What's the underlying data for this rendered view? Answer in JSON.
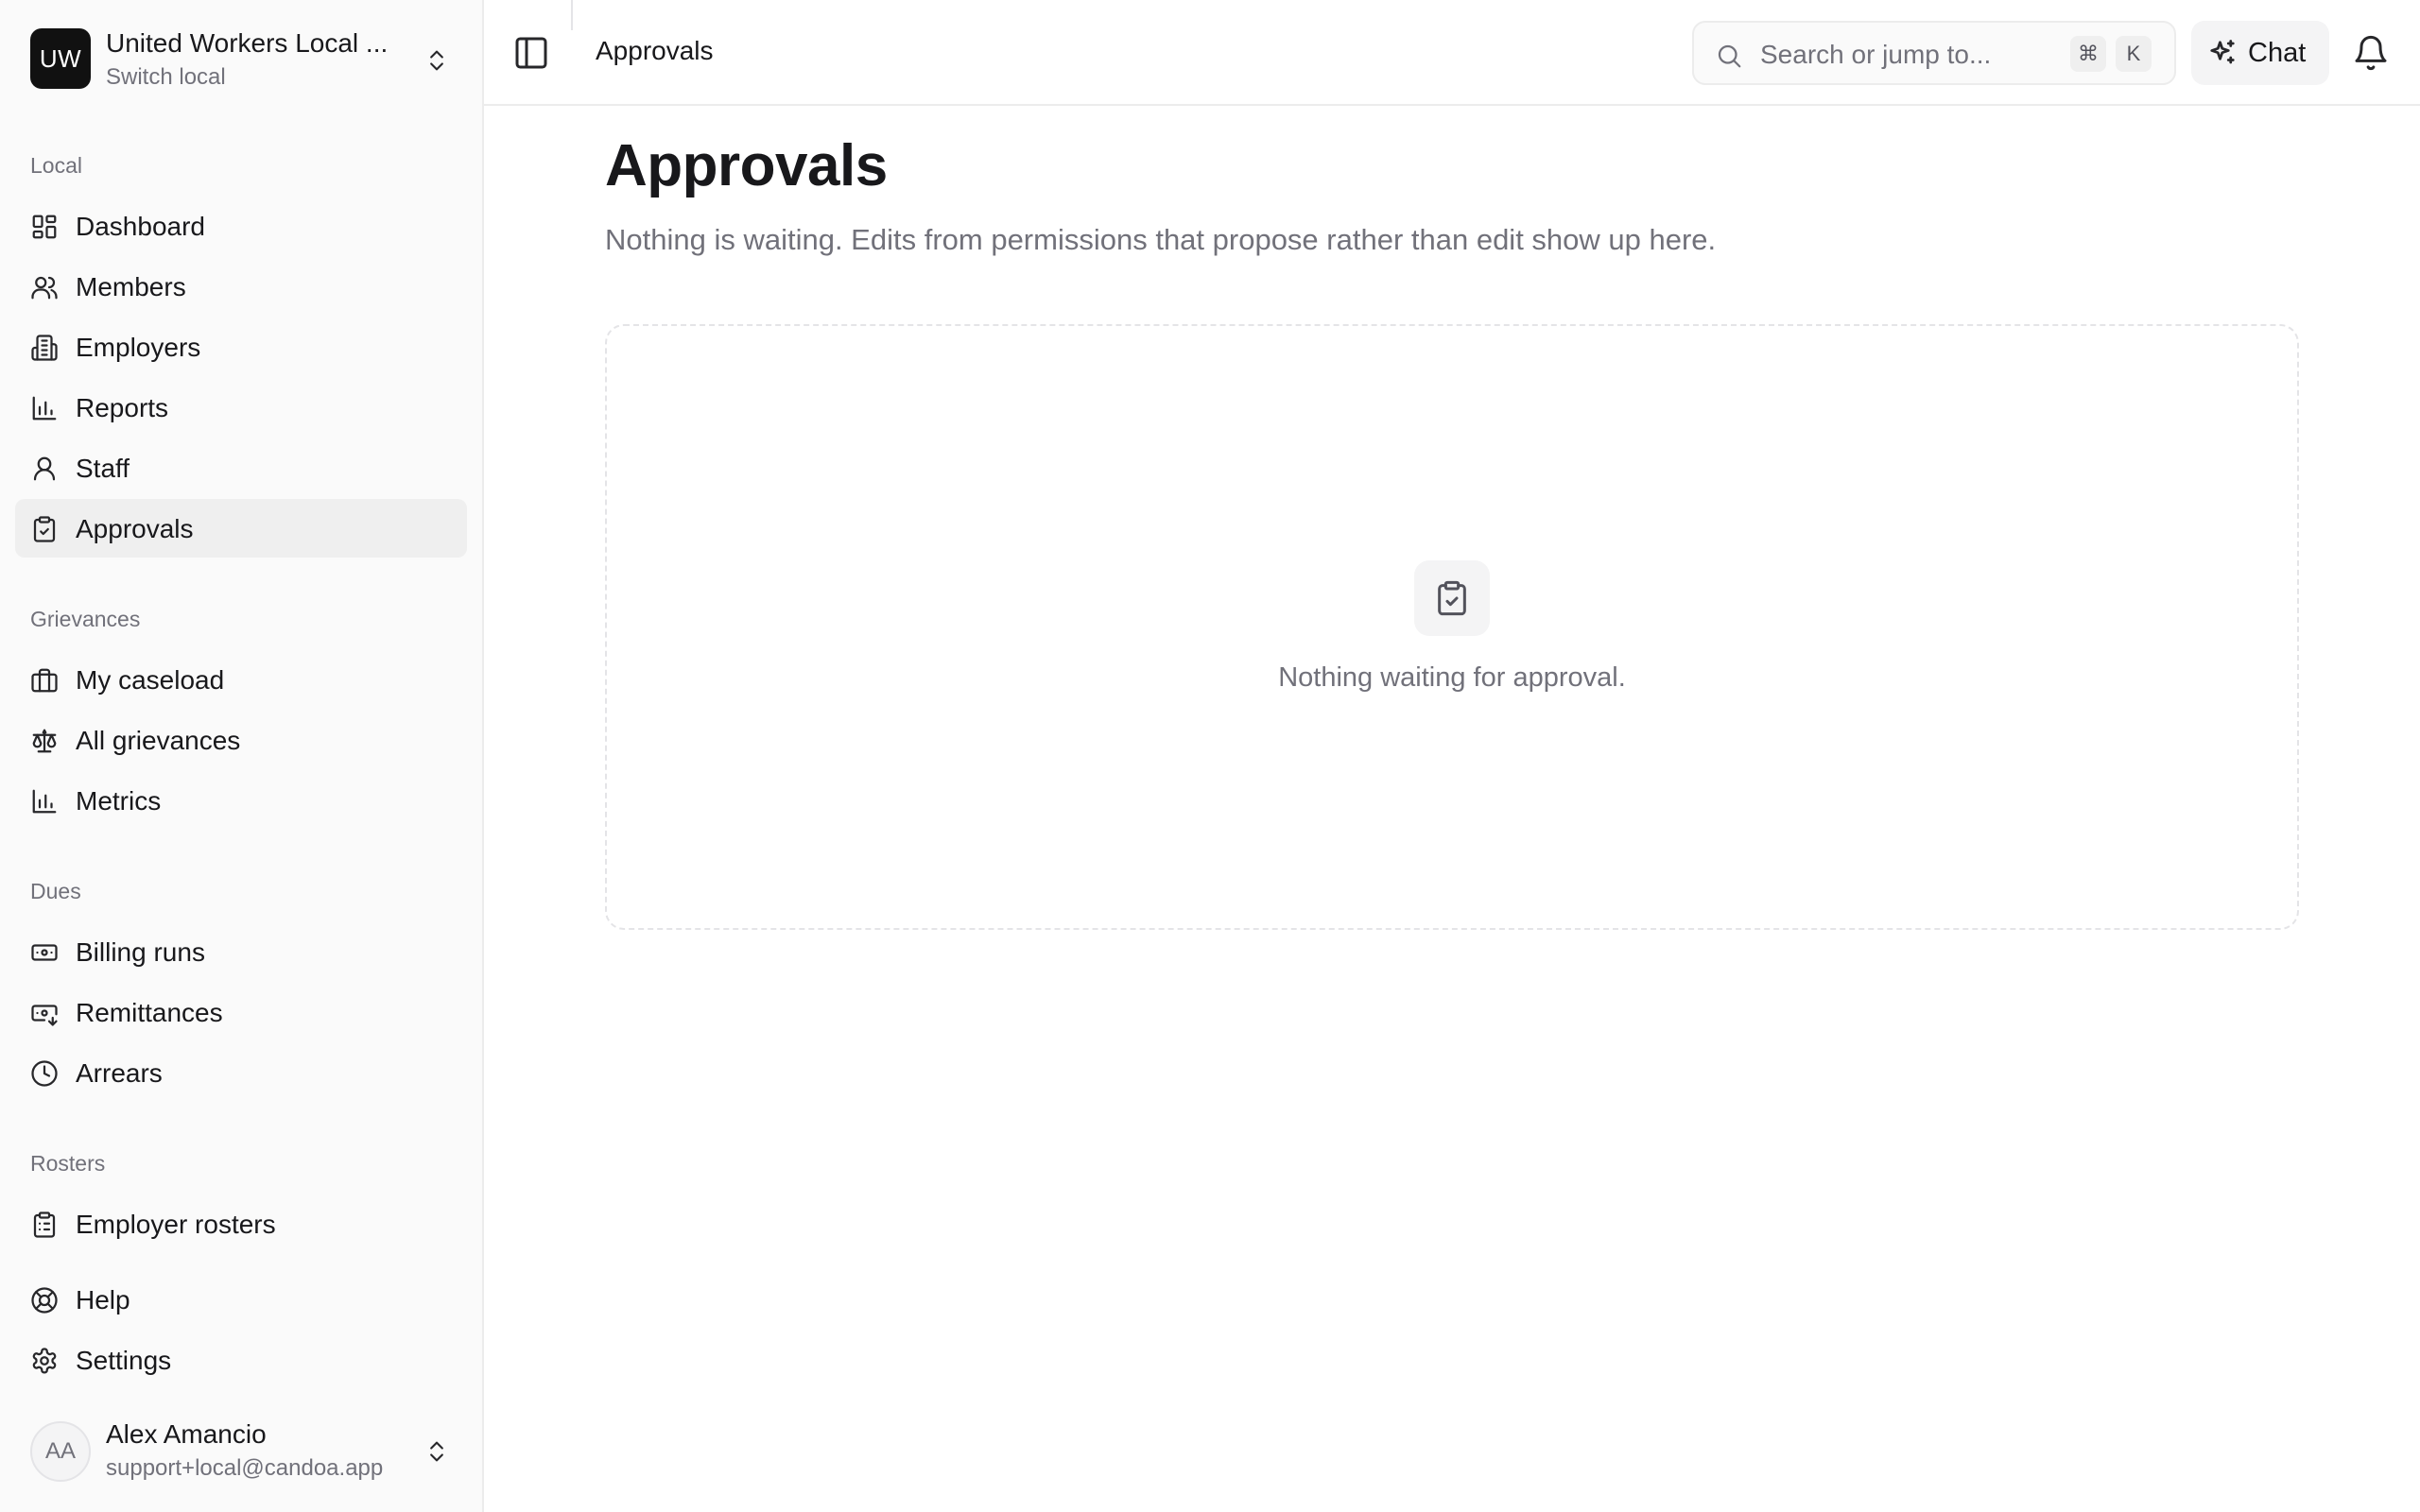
{
  "org": {
    "logo_text": "UW",
    "name": "United Workers Local ...",
    "subtitle": "Switch local"
  },
  "sidebar": {
    "sections": [
      {
        "label": "Local"
      },
      {
        "label": "Grievances"
      },
      {
        "label": "Dues"
      },
      {
        "label": "Rosters"
      }
    ],
    "items": [
      {
        "label": "Dashboard",
        "icon": "dashboard-icon"
      },
      {
        "label": "Members",
        "icon": "users-icon"
      },
      {
        "label": "Employers",
        "icon": "building-icon"
      },
      {
        "label": "Reports",
        "icon": "bar-chart-icon"
      },
      {
        "label": "Staff",
        "icon": "user-icon"
      },
      {
        "label": "Approvals",
        "icon": "clipboard-check-icon",
        "active": true
      },
      {
        "label": "My caseload",
        "icon": "briefcase-icon"
      },
      {
        "label": "All grievances",
        "icon": "scale-icon"
      },
      {
        "label": "Metrics",
        "icon": "bar-chart-icon"
      },
      {
        "label": "Billing runs",
        "icon": "banknote-icon"
      },
      {
        "label": "Remittances",
        "icon": "banknote-arrow-icon"
      },
      {
        "label": "Arrears",
        "icon": "clock-icon"
      },
      {
        "label": "Employer rosters",
        "icon": "clipboard-list-icon"
      },
      {
        "label": "Help",
        "icon": "life-buoy-icon"
      },
      {
        "label": "Settings",
        "icon": "gear-icon"
      }
    ]
  },
  "user": {
    "initials": "AA",
    "name": "Alex Amancio",
    "email": "support+local@candoa.app"
  },
  "header": {
    "breadcrumb": "Approvals",
    "search_placeholder": "Search or jump to...",
    "shortcut_keys": [
      "⌘",
      "K"
    ],
    "chat_label": "Chat"
  },
  "main": {
    "title": "Approvals",
    "description": "Nothing is waiting. Edits from permissions that propose rather than edit show up here.",
    "empty_state_text": "Nothing waiting for approval."
  }
}
